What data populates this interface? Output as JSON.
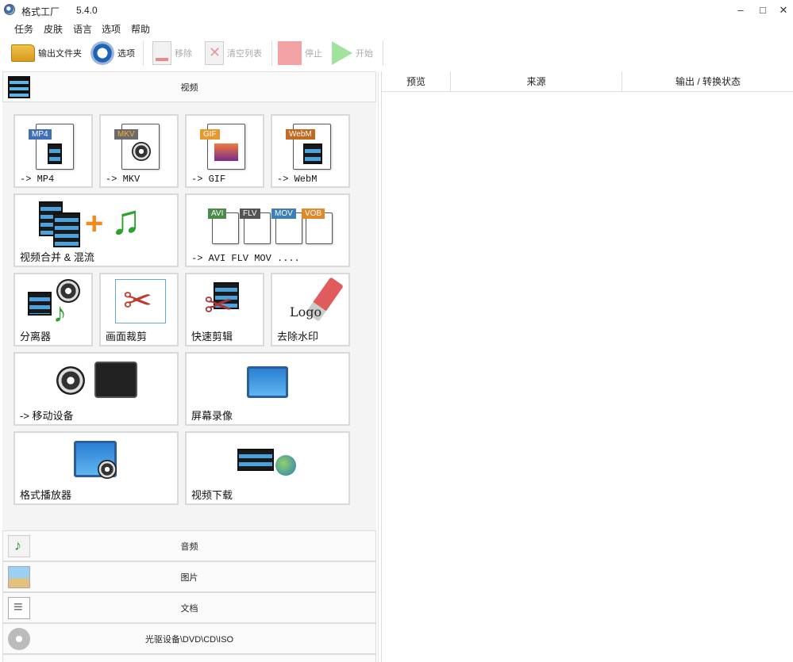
{
  "window": {
    "title": "格式工厂",
    "version": "5.4.0",
    "minimize": "–",
    "maximize": "□",
    "close": "✕"
  },
  "menu": [
    "任务",
    "皮肤",
    "语言",
    "选项",
    "帮助"
  ],
  "toolbar": {
    "output_folder": "输出文件夹",
    "options": "选项",
    "remove": "移除",
    "clear_list": "清空列表",
    "stop": "停止",
    "start": "开始"
  },
  "categories": {
    "video": "视频",
    "audio": "音频",
    "image": "图片",
    "document": "文档",
    "disc": "光驱设备\\DVD\\CD\\ISO"
  },
  "video_tiles": {
    "mp4": {
      "label": "-> MP4",
      "tag": "MP4"
    },
    "mkv": {
      "label": "-> MKV",
      "tag": "MKV"
    },
    "gif": {
      "label": "-> GIF",
      "tag": "GIF"
    },
    "webm": {
      "label": "-> WebM",
      "tag": "WebM"
    },
    "merge": {
      "label": "视频合并 & 混流"
    },
    "others": {
      "label": "-> AVI FLV MOV ....",
      "tags": [
        "AVI",
        "FLV",
        "MOV",
        "VOB"
      ]
    },
    "splitter": {
      "label": "分离器"
    },
    "crop": {
      "label": "画面裁剪"
    },
    "quick_cut": {
      "label": "快速剪辑"
    },
    "watermark": {
      "label": "去除水印",
      "logo_text": "Logo"
    },
    "mobile": {
      "label": "-> 移动设备"
    },
    "screen_record": {
      "label": "屏幕录像"
    },
    "player": {
      "label": "格式播放器"
    },
    "download": {
      "label": "视频下载"
    }
  },
  "task_table": {
    "columns": [
      "预览",
      "来源",
      "输出 / 转换状态"
    ]
  },
  "colors": {
    "mp4_tag": "#3f6fb5",
    "mkv_tag": "#6b6b6b",
    "gif_tag": "#e69a2e",
    "webm_tag": "#c46a1e"
  }
}
